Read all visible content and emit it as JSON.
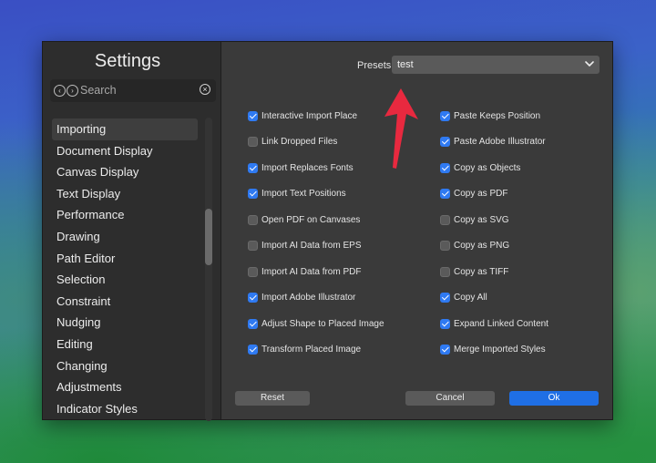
{
  "sidebar": {
    "title": "Settings",
    "search_placeholder": "Search",
    "items": [
      {
        "label": "Importing"
      },
      {
        "label": "Document Display"
      },
      {
        "label": "Canvas Display"
      },
      {
        "label": "Text Display"
      },
      {
        "label": "Performance"
      },
      {
        "label": "Drawing"
      },
      {
        "label": "Path Editor"
      },
      {
        "label": "Selection"
      },
      {
        "label": "Constraint"
      },
      {
        "label": "Nudging"
      },
      {
        "label": "Editing"
      },
      {
        "label": "Changing"
      },
      {
        "label": "Adjustments"
      },
      {
        "label": "Indicator Styles"
      }
    ],
    "selected_item": "Importing"
  },
  "presets": {
    "label": "Presets",
    "value": "test"
  },
  "options_left": [
    {
      "label": "Interactive Import Place",
      "checked": true
    },
    {
      "label": "Link Dropped Files",
      "checked": false
    },
    {
      "label": "Import Replaces Fonts",
      "checked": true
    },
    {
      "label": "Import Text Positions",
      "checked": true
    },
    {
      "label": "Open PDF on Canvases",
      "checked": false
    },
    {
      "label": "Import AI Data from EPS",
      "checked": false
    },
    {
      "label": "Import AI Data from PDF",
      "checked": false
    },
    {
      "label": "Import Adobe Illustrator",
      "checked": true
    },
    {
      "label": "Adjust Shape to Placed Image",
      "checked": true
    },
    {
      "label": "Transform Placed Image",
      "checked": true
    }
  ],
  "options_right": [
    {
      "label": "Paste Keeps Position",
      "checked": true
    },
    {
      "label": "Paste Adobe Illustrator",
      "checked": true
    },
    {
      "label": "Copy as Objects",
      "checked": true
    },
    {
      "label": "Copy as PDF",
      "checked": true
    },
    {
      "label": "Copy as SVG",
      "checked": false
    },
    {
      "label": "Copy as PNG",
      "checked": false
    },
    {
      "label": "Copy as TIFF",
      "checked": false
    },
    {
      "label": "Copy All",
      "checked": true
    },
    {
      "label": "Expand Linked Content",
      "checked": true
    },
    {
      "label": "Merge Imported Styles",
      "checked": true
    }
  ],
  "buttons": {
    "reset": "Reset",
    "cancel": "Cancel",
    "ok": "Ok"
  },
  "colors": {
    "accent": "#2f7af2",
    "primary_button": "#1f6fe5",
    "annotation_arrow": "#e8293f"
  }
}
